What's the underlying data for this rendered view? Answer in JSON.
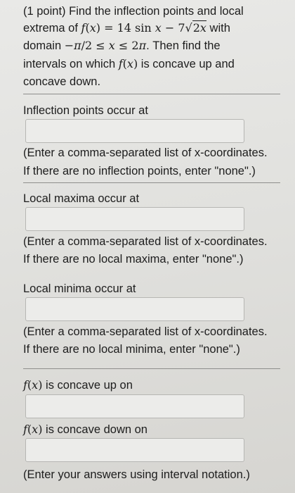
{
  "header": {
    "points": "(1 point)",
    "line1_a": "Find the inflection points and local",
    "line2_a": "extrema of",
    "line2_func": "f(x) = 14 sin x − 7√2x",
    "line2_b": "with",
    "line3_a": "domain",
    "line3_domain": "−π/2 ≤ x ≤ 2π",
    "line3_b": ". Then find the",
    "line4_a": "intervals on which",
    "line4_func": "f(x)",
    "line4_b": "is concave up and",
    "line5": "concave down."
  },
  "inflection": {
    "prompt": "Inflection points occur at",
    "answer": "",
    "hint1": "(Enter a comma-separated list of x-coordinates.",
    "hint2": "If there are no inflection points, enter \"none\".)"
  },
  "maxima": {
    "prompt": "Local maxima occur at",
    "answer": "",
    "hint1": "(Enter a comma-separated list of x-coordinates.",
    "hint2": "If there are no local maxima, enter \"none\".)"
  },
  "minima": {
    "prompt": "Local minima occur at",
    "answer": "",
    "hint1": "(Enter a comma-separated list of x-coordinates.",
    "hint2": "If there are no local minima, enter \"none\".)"
  },
  "concave_up": {
    "func": "f(x)",
    "label": "is concave up on",
    "answer": ""
  },
  "concave_down": {
    "func": "f(x)",
    "label": "is concave down on",
    "answer": ""
  },
  "footer": {
    "note": "(Enter your answers using interval notation.)"
  }
}
